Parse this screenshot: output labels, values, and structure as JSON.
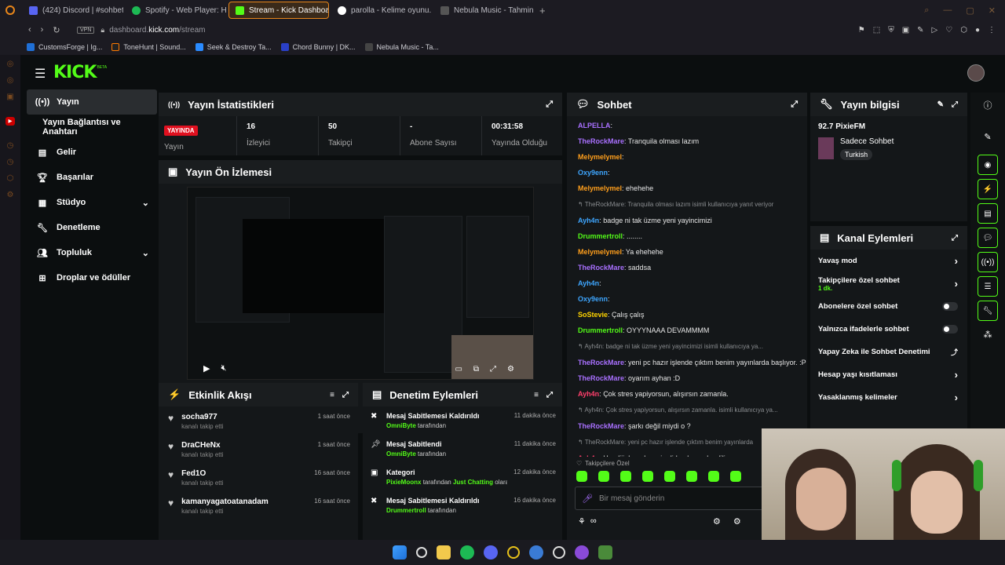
{
  "browser": {
    "tabs": [
      {
        "label": "(424) Discord | #sohbet | P",
        "color": "#5865f2"
      },
      {
        "label": "Spotify - Web Player: Her",
        "color": "#1db954"
      },
      {
        "label": "Stream - Kick Dashboard",
        "color": "#53fc18",
        "active": true
      },
      {
        "label": "parolla - Kelime oyunu. Gü",
        "color": "#ffffff"
      },
      {
        "label": "Nebula Music - Tahmin Oy",
        "color": "#3a3a3a"
      }
    ],
    "url_prefix": "dashboard.",
    "url_domain": "kick.com",
    "url_path": "/stream",
    "vpn": "VPN",
    "bookmarks": [
      "CustomsForge | Ig...",
      "ToneHunt | Sound...",
      "Seek & Destroy Ta...",
      "Chord Bunny | DK...",
      "Nebula Music - Ta..."
    ]
  },
  "brand": {
    "logo": "KICK",
    "beta": "BETA",
    "accent": "#53fc18"
  },
  "nav": {
    "items": [
      {
        "label": "Yayın",
        "icon": "radio-icon",
        "active": true
      },
      {
        "label": "Yayın Bağlantısı ve Anahtarı",
        "icon": ""
      },
      {
        "label": "Gelir",
        "icon": "bar-chart-icon"
      },
      {
        "label": "Başarılar",
        "icon": "trophy-icon"
      },
      {
        "label": "Stüdyo",
        "icon": "layout-icon",
        "chevron": true
      },
      {
        "label": "Denetleme",
        "icon": "wrench-icon"
      },
      {
        "label": "Topluluk",
        "icon": "people-icon",
        "chevron": true
      },
      {
        "label": "Droplar ve ödüller",
        "icon": "drop-icon"
      }
    ]
  },
  "stats": {
    "title": "Yayın İstatistikleri",
    "live_badge": "YAYINDA",
    "live_label": "Yayın",
    "cells": [
      {
        "value": "16",
        "label": "İzleyici"
      },
      {
        "value": "50",
        "label": "Takipçi"
      },
      {
        "value": "-",
        "label": "Abone Sayısı"
      },
      {
        "value": "00:31:58",
        "label": "Yayında Olduğu"
      }
    ]
  },
  "preview": {
    "title": "Yayın Ön İzlemesi"
  },
  "activity": {
    "title": "Etkinlik Akışı",
    "items": [
      {
        "name": "socha977",
        "sub": "kanalı takip etti",
        "time": "1 saat önce"
      },
      {
        "name": "DraCHeNx",
        "sub": "kanalı takip etti",
        "time": "1 saat önce"
      },
      {
        "name": "Fed1O",
        "sub": "kanalı takip etti",
        "time": "16 saat önce"
      },
      {
        "name": "kamanyagatoatanadam",
        "sub": "kanalı takip etti",
        "time": "16 saat önce"
      }
    ]
  },
  "modlog": {
    "title": "Denetim Eylemleri",
    "items": [
      {
        "action": "Mesaj Sabitlemesi Kaldırıldı",
        "user": "OmniByte",
        "suffix": "tarafından",
        "time": "11 dakika önce",
        "icon": "unpin-icon"
      },
      {
        "action": "Mesaj Sabitlendi",
        "user": "OmniByte",
        "suffix": "tarafından",
        "time": "11 dakika önce",
        "icon": "pin-icon"
      },
      {
        "action": "Kategori",
        "user": "PixieMoonx",
        "suffix": "tarafından",
        "extra_green": "Just Chatting",
        "extra": "olarak değiştirildi",
        "time": "12 dakika önce",
        "icon": "category-icon"
      },
      {
        "action": "Mesaj Sabitlemesi Kaldırıldı",
        "user": "Drummertroll",
        "suffix": "tarafından",
        "time": "16 dakika önce",
        "icon": "unpin-icon"
      }
    ]
  },
  "chat": {
    "title": "Sohbet",
    "messages": [
      {
        "user": "ALPELLA",
        "color": "#a970ff",
        "text": ""
      },
      {
        "user": "TheRockMare",
        "color": "#a970ff",
        "text": "Tranquila olması lazım"
      },
      {
        "user": "Melymelymel",
        "color": "#ff9f1c",
        "text": ""
      },
      {
        "user": "Oxy9enn",
        "color": "#3ea6ff",
        "text": ""
      },
      {
        "user": "Melymelymel",
        "color": "#ff9f1c",
        "text": "ehehehe"
      },
      {
        "reply": "TheRockMare: Tranquila olması lazım isimli kullanıcıya yanıt veriyor"
      },
      {
        "user": "Ayh4n",
        "color": "#3ea6ff",
        "text": "badge ni tak üzme yeni yayincimizi"
      },
      {
        "user": "Drummertroll",
        "color": "#53fc18",
        "text": "........"
      },
      {
        "user": "Melymelymel",
        "color": "#ff9f1c",
        "text": "Ya ehehehe"
      },
      {
        "user": "TheRockMare",
        "color": "#a970ff",
        "text": "saddsa"
      },
      {
        "user": "Ayh4n",
        "color": "#3ea6ff",
        "text": ""
      },
      {
        "user": "Oxy9enn",
        "color": "#3ea6ff",
        "text": ""
      },
      {
        "user": "SoStevie",
        "color": "#ffd400",
        "text": "Çalış çalış"
      },
      {
        "user": "Drummertroll",
        "color": "#53fc18",
        "text": "OYYYNAAA DEVAMMMM"
      },
      {
        "reply": "Ayh4n: badge ni tak üzme yeni yayincimizi isimli kullanıcıya ya..."
      },
      {
        "user": "TheRockMare",
        "color": "#a970ff",
        "text": "yeni pc hazır işlende çıktım benim yayınlarda başlıyor. :P"
      },
      {
        "user": "TheRockMare",
        "color": "#a970ff",
        "text": "oyarım ayhan :D"
      },
      {
        "user": "Ayh4n",
        "color": "#ff3f6c",
        "text": "Çok stres yapiyorsun, alışırsın zamanla."
      },
      {
        "reply": "Ayh4n: Çok stres yapiyorsun, alışırsın zamanla. isimli kullanıcıya ya..."
      },
      {
        "user": "TheRockMare",
        "color": "#a970ff",
        "text": "şarkı değil miydi o ?"
      },
      {
        "reply": "TheRockMare: yeni pc hazır işlende çıktım benim yayınlarda"
      },
      {
        "user": "Ayh4n",
        "color": "#ff3f6c",
        "text": "Haydiii, hayırlısı. şimdiden başarılar diliyorum."
      }
    ],
    "followers_only": "Takipçilere Özel",
    "input_placeholder": "Bir mesaj gönderin"
  },
  "info": {
    "title": "Yayın bilgisi",
    "stream_title": "92.7 PixieFM",
    "category": "Sadece Sohbet",
    "language": "Turkish"
  },
  "channel_actions": {
    "title": "Kanal Eylemleri",
    "items": [
      {
        "label": "Yavaş mod",
        "type": "chevron"
      },
      {
        "label": "Takipçilere özel sohbet",
        "sub": "1 dk.",
        "type": "chevron"
      },
      {
        "label": "Abonelere özel sohbet",
        "type": "toggle"
      },
      {
        "label": "Yalnızca ifadelerle sohbet",
        "type": "toggle"
      },
      {
        "label": "Yapay Zeka ile Sohbet Denetimi",
        "type": "external"
      },
      {
        "label": "Hesap yaşı kısıtlaması",
        "type": "chevron"
      },
      {
        "label": "Yasaklanmış kelimeler",
        "type": "chevron"
      }
    ]
  }
}
